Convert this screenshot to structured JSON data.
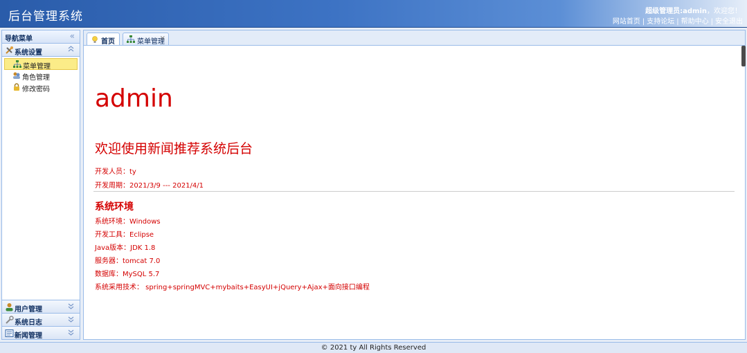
{
  "header": {
    "title": "后台管理系统",
    "user_role": "超级管理员:",
    "user_name": "admin",
    "greeting": "，欢迎您！",
    "links": [
      "网站首页",
      "支持论坛",
      "帮助中心",
      "安全退出"
    ]
  },
  "sidebar": {
    "title": "导航菜单",
    "collapse_glyph": "«",
    "groups": [
      {
        "label": "系统设置",
        "icon": "tools-icon",
        "expanded": true,
        "items": [
          {
            "label": "菜单管理",
            "icon": "org-tree-icon",
            "active": true
          },
          {
            "label": "角色管理",
            "icon": "role-users-icon",
            "active": false
          },
          {
            "label": "修改密码",
            "icon": "lock-icon",
            "active": false
          }
        ]
      },
      {
        "label": "用户管理",
        "icon": "user-icon",
        "expanded": false
      },
      {
        "label": "系统日志",
        "icon": "wrench-icon",
        "expanded": false
      },
      {
        "label": "新闻管理",
        "icon": "news-icon",
        "expanded": false
      }
    ]
  },
  "tabs": [
    {
      "label": "首页",
      "icon": "bulb-icon",
      "selected": true,
      "closable": false
    },
    {
      "label": "菜单管理",
      "icon": "org-tree-icon",
      "selected": false,
      "closable": true
    }
  ],
  "content": {
    "heading": "admin",
    "welcome": "欢迎使用新闻推荐系统后台",
    "developer": "开发人员：ty",
    "period": "开发周期：2021/3/9 --- 2021/4/1",
    "env_title": "系统环境",
    "env_lines": [
      "系统环境：Windows",
      "开发工具：Eclipse",
      "Java版本：JDK 1.8",
      "服务器：tomcat 7.0",
      "数据库：MySQL 5.7",
      "系统采用技术： spring+springMVC+mybaits+EasyUI+jQuery+Ajax+面向接口编程"
    ]
  },
  "footer": {
    "text": "© 2021 ty All Rights Reserved"
  },
  "colors": {
    "header_blue": "#2a5caa",
    "border_blue": "#99bbe8",
    "content_red": "#d40000",
    "active_item": "#fbec88"
  }
}
